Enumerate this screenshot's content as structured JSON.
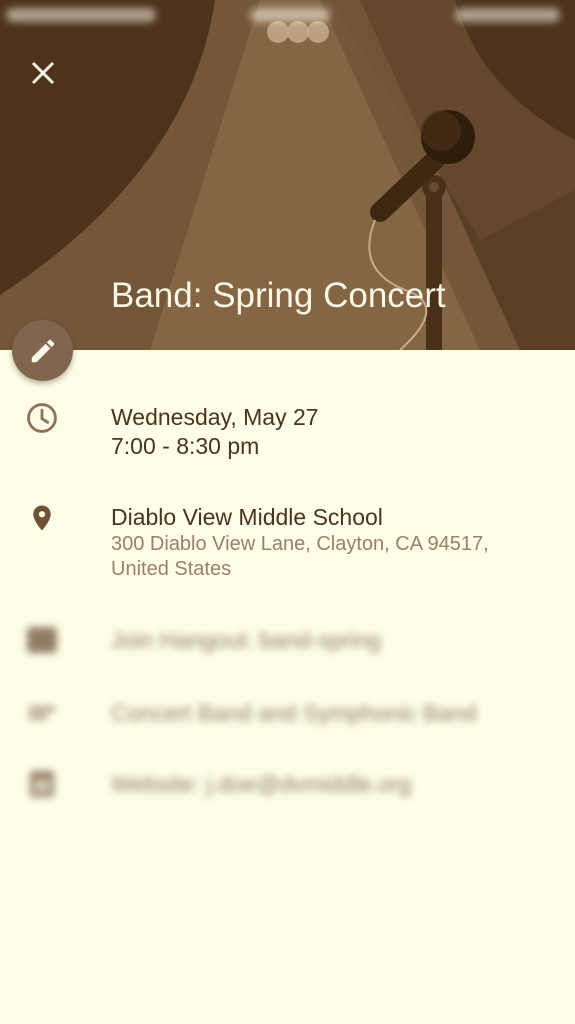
{
  "header": {
    "title": "Band: Spring Concert",
    "close_icon": "close-icon",
    "edit_icon": "pencil-icon",
    "colors": {
      "header_bg": "#5a3e25",
      "page_bg": "#fefee6",
      "fab_bg": "#80664e",
      "title_text": "#fbf6e6"
    }
  },
  "details": {
    "date": "Wednesday, May 27",
    "time": "7:00 - 8:30 pm",
    "location_name": "Diablo View Middle School",
    "location_address": "300 Diablo View Lane, Clayton, CA 94517, United States",
    "time_icon": "clock-icon",
    "location_icon": "location-pin-icon"
  },
  "blurred_rows": [
    {
      "icon": "hangout-icon",
      "text": "Join Hangout: band-spring"
    },
    {
      "icon": "notes-icon",
      "text": "Concert Band and Symphonic Band"
    },
    {
      "icon": "calendar-icon",
      "text": "Website: j.doe@dvmiddle.org"
    }
  ]
}
